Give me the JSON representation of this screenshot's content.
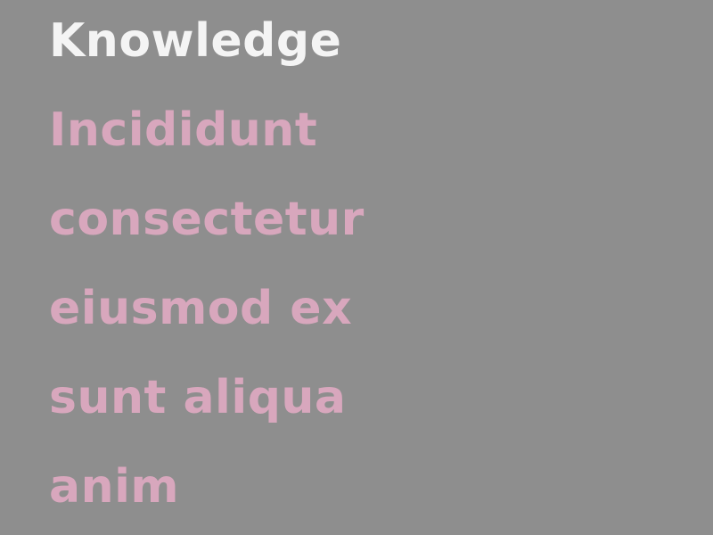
{
  "menu": {
    "title": "Knowledge",
    "items": [
      {
        "label": "Incididunt"
      },
      {
        "label": "consectetur"
      },
      {
        "label": "eiusmod ex"
      },
      {
        "label": "sunt aliqua"
      },
      {
        "label": "anim"
      }
    ]
  },
  "colors": {
    "background": "#8e8e8e",
    "title": "#f4f4f4",
    "item": "#d8a7bd"
  }
}
